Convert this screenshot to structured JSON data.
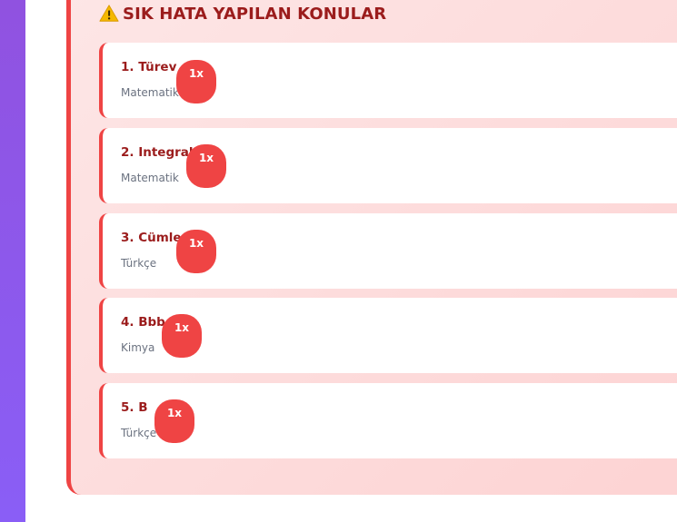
{
  "section": {
    "title": "SIK HATA YAPILAN KONULAR",
    "icon": "warning-icon"
  },
  "colors": {
    "accent": "#ef4444",
    "title_text": "#9b1c1c",
    "subtitle_text": "#6b7280",
    "sidebar": "#8a5ef6"
  },
  "items": [
    {
      "title": "1. Türev",
      "subject": "Matematik",
      "count": "1x"
    },
    {
      "title": "2. Integral",
      "subject": "Matematik",
      "count": "1x"
    },
    {
      "title": "3. Cümle",
      "subject": "Türkçe",
      "count": "1x"
    },
    {
      "title": "4. Bbb",
      "subject": "Kimya",
      "count": "1x"
    },
    {
      "title": "5. B",
      "subject": "Türkçe",
      "count": "1x"
    }
  ]
}
